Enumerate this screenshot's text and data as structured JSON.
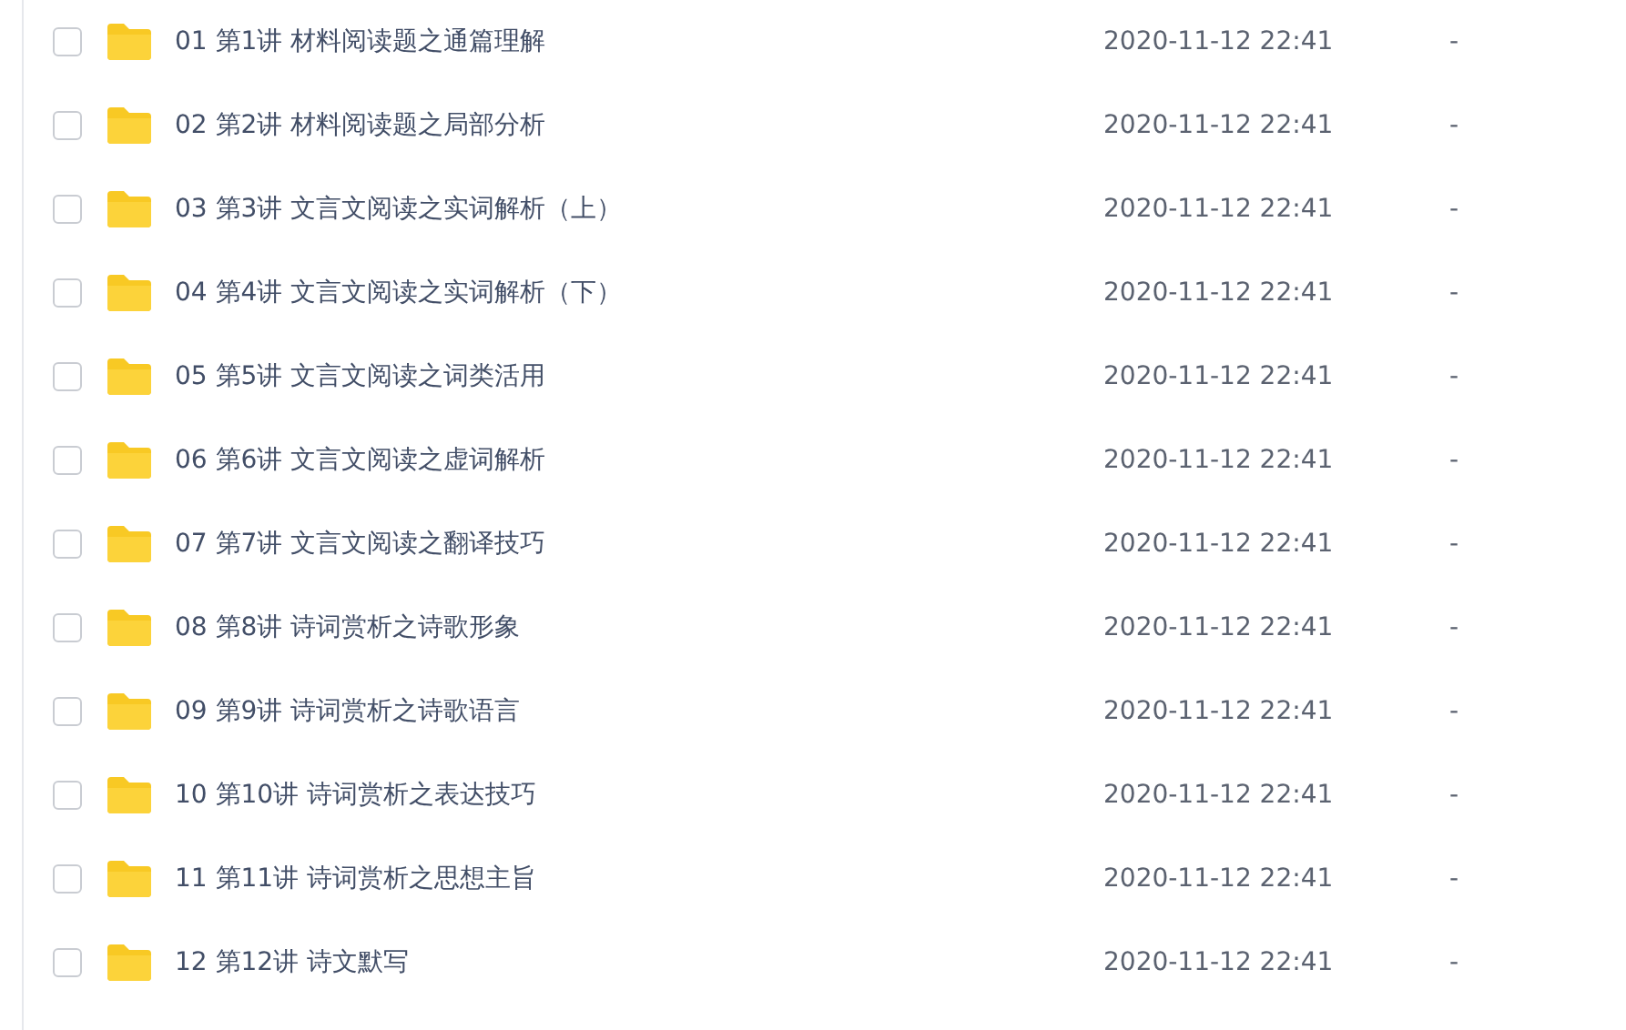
{
  "files": [
    {
      "name": "01 第1讲 材料阅读题之通篇理解",
      "modified": "2020-11-12 22:41",
      "size": "-",
      "selected": false
    },
    {
      "name": "02 第2讲 材料阅读题之局部分析",
      "modified": "2020-11-12 22:41",
      "size": "-",
      "selected": false
    },
    {
      "name": "03 第3讲 文言文阅读之实词解析（上）",
      "modified": "2020-11-12 22:41",
      "size": "-",
      "selected": false
    },
    {
      "name": "04 第4讲 文言文阅读之实词解析（下）",
      "modified": "2020-11-12 22:41",
      "size": "-",
      "selected": false
    },
    {
      "name": "05 第5讲 文言文阅读之词类活用",
      "modified": "2020-11-12 22:41",
      "size": "-",
      "selected": false
    },
    {
      "name": "06 第6讲 文言文阅读之虚词解析",
      "modified": "2020-11-12 22:41",
      "size": "-",
      "selected": false
    },
    {
      "name": "07 第7讲 文言文阅读之翻译技巧",
      "modified": "2020-11-12 22:41",
      "size": "-",
      "selected": false
    },
    {
      "name": "08 第8讲 诗词赏析之诗歌形象",
      "modified": "2020-11-12 22:41",
      "size": "-",
      "selected": false
    },
    {
      "name": "09 第9讲 诗词赏析之诗歌语言",
      "modified": "2020-11-12 22:41",
      "size": "-",
      "selected": false
    },
    {
      "name": "10 第10讲 诗词赏析之表达技巧",
      "modified": "2020-11-12 22:41",
      "size": "-",
      "selected": false
    },
    {
      "name": "11 第11讲 诗词赏析之思想主旨",
      "modified": "2020-11-12 22:41",
      "size": "-",
      "selected": false
    },
    {
      "name": "12 第12讲 诗文默写",
      "modified": "2020-11-12 22:41",
      "size": "-",
      "selected": false
    }
  ]
}
